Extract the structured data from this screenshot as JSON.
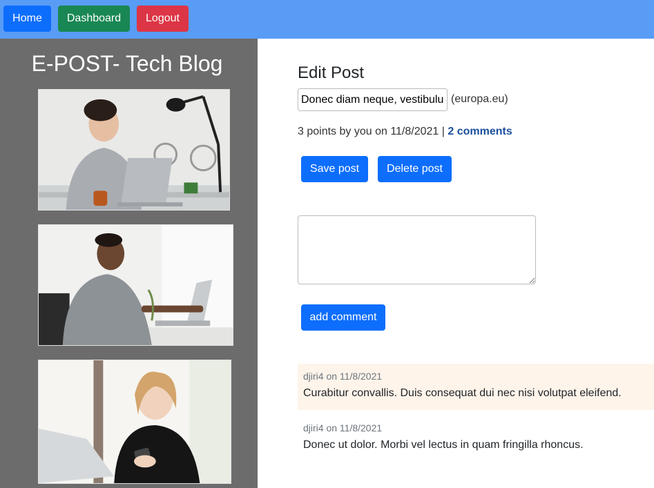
{
  "nav": {
    "home_label": "Home",
    "dashboard_label": "Dashboard",
    "logout_label": "Logout"
  },
  "sidebar": {
    "title": "E-POST- Tech Blog",
    "images": [
      "woman-with-laptop-photo",
      "man-with-laptop-photo",
      "woman-with-phone-photo"
    ]
  },
  "post": {
    "heading": "Edit Post",
    "title_value": "Donec diam neque, vestibulum",
    "domain": "(europa.eu)",
    "meta_prefix": "3 points by you on 11/8/2021 | ",
    "comments_link": "2 comments",
    "save_label": "Save post",
    "delete_label": "Delete post"
  },
  "comment_form": {
    "textarea_value": "",
    "add_label": "add comment"
  },
  "comments": [
    {
      "meta": "djiri4 on 11/8/2021",
      "text": "Curabitur convallis. Duis consequat dui nec nisi volutpat eleifend."
    },
    {
      "meta": "djiri4 on 11/8/2021",
      "text": "Donec ut dolor. Morbi vel lectus in quam fringilla rhoncus."
    }
  ],
  "colors": {
    "topbar": "#589cf5",
    "sidebar": "#6c6c6c",
    "primary": "#0d6efd",
    "success": "#198754",
    "danger": "#dc3545",
    "highlight_comment": "#fef4ea"
  }
}
